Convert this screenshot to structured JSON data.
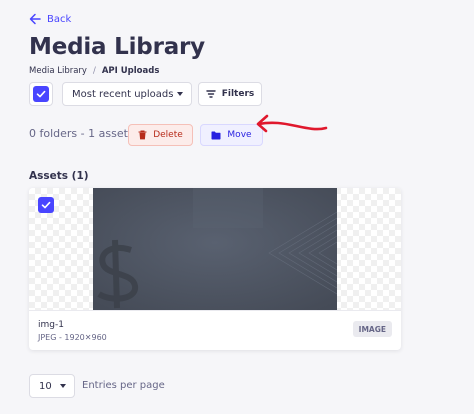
{
  "header": {
    "back_label": "Back",
    "title": "Media Library",
    "breadcrumb": {
      "root": "Media Library",
      "separator": "/",
      "current": "API Uploads"
    }
  },
  "toolbar": {
    "sort_value": "Most recent uploads",
    "filters_label": "Filters"
  },
  "selection": {
    "summary": "0 folders - 1 asset",
    "delete_label": "Delete",
    "move_label": "Move"
  },
  "assets": {
    "heading": "Assets (1)",
    "items": [
      {
        "name": "img-1",
        "meta": "JPEG - 1920✕960",
        "type": "IMAGE"
      }
    ]
  },
  "pagination": {
    "per_page_value": "10",
    "per_page_label": "Entries per page"
  },
  "icons": {
    "back": "arrow-left-icon",
    "checkbox": "check-icon",
    "sort": "chevron-down-icon",
    "filters": "filter-icon",
    "delete": "trash-icon",
    "move": "folder-icon"
  },
  "colors": {
    "primary": "#4945ff",
    "danger": "#b72b1a",
    "annotation": "#e0182d"
  }
}
